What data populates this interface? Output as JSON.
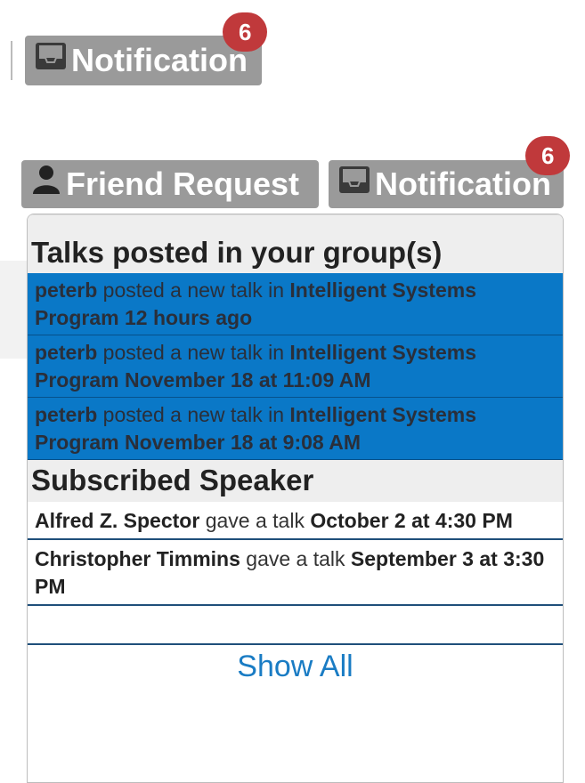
{
  "top_bar": {
    "notification_label": "Notification",
    "notification_count": "6"
  },
  "nav": {
    "friend_request_label": "Friend Request",
    "notification_label": "Notification",
    "notification_count": "6"
  },
  "dropdown": {
    "talks_header": "Talks posted in your group(s)",
    "talks": [
      {
        "user": "peterb",
        "action": " posted a new talk in ",
        "group": "Intelligent Systems Program",
        "time": "12 hours ago"
      },
      {
        "user": "peterb",
        "action": " posted a new talk in ",
        "group": "Intelligent Systems Program",
        "time": "November 18 at 11:09 AM"
      },
      {
        "user": "peterb",
        "action": " posted a new talk in ",
        "group": "Intelligent Systems Program",
        "time": "November 18 at 9:08 AM"
      }
    ],
    "speaker_header": "Subscribed Speaker",
    "speakers": [
      {
        "name": "Alfred Z. Spector",
        "action": " gave a talk ",
        "time": "October 2 at 4:30 PM"
      },
      {
        "name": "Christopher Timmins",
        "action": " gave a talk ",
        "time": "September 3 at 3:30 PM"
      }
    ],
    "show_all_label": "Show All"
  },
  "colors": {
    "button_bg": "#9a9a9a",
    "badge_bg": "#c0393b",
    "talk_row_bg": "#0a78c7",
    "link_blue": "#1a7cc4"
  },
  "icons": {
    "notification": "inbox-icon",
    "friend_request": "user-icon"
  }
}
